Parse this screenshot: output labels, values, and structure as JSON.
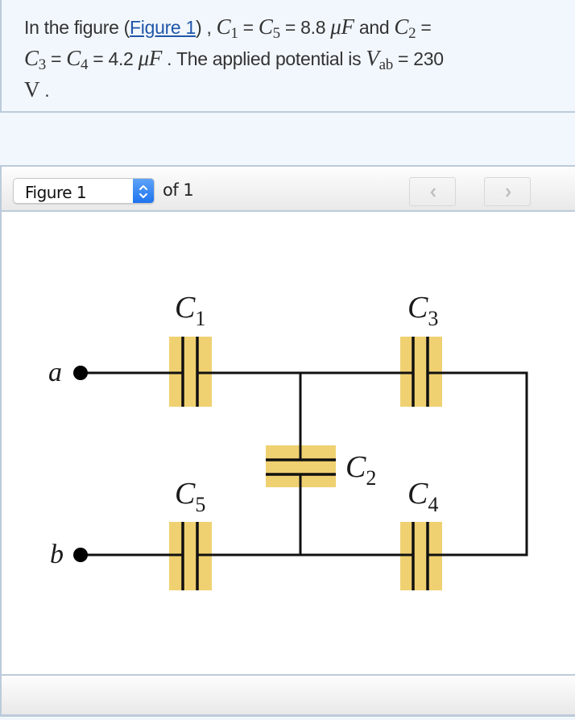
{
  "problem": {
    "text_intro": "In the figure (",
    "figure_link": "Figure 1",
    "text_after_link": ") , ",
    "c1_sym": "C",
    "c1_sub": "1",
    "eq1": " = ",
    "c5_sym": "C",
    "c5_sub": "5",
    "eq2": " = 8.8 ",
    "unit1": "μF",
    "and": " and ",
    "c2_sym": "C",
    "c2_sub": "2",
    "eq3": " = ",
    "c3_sym": "C",
    "c3_sub": "3",
    "eq4": " = ",
    "c4_sym": "C",
    "c4_sub": "4",
    "eq5": " = 4.2 ",
    "unit2": "μF",
    "sentence2": " . The applied potential is ",
    "v_sym": "V",
    "v_sub": "ab",
    "eq6": " = 230",
    "unit3": "V",
    "period": " ."
  },
  "figure_toolbar": {
    "select_value": "Figure 1",
    "of_label": "of 1",
    "prev_icon": "chevron-left-icon",
    "next_icon": "chevron-right-icon"
  },
  "circuit": {
    "terminal_a": "a",
    "terminal_b": "b",
    "capacitors": [
      {
        "sym": "C",
        "sub": "1"
      },
      {
        "sym": "C",
        "sub": "2"
      },
      {
        "sym": "C",
        "sub": "3"
      },
      {
        "sym": "C",
        "sub": "4"
      },
      {
        "sym": "C",
        "sub": "5"
      }
    ],
    "plate_color": "#f0d171",
    "wire_color": "#111111"
  }
}
